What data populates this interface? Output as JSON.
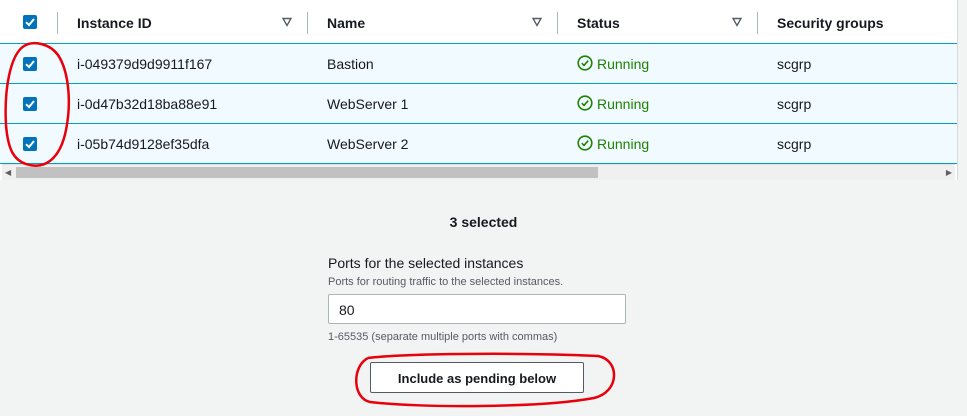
{
  "table": {
    "columns": [
      {
        "label": "Instance ID"
      },
      {
        "label": "Name"
      },
      {
        "label": "Status"
      },
      {
        "label": "Security groups"
      }
    ],
    "rows": [
      {
        "instance_id": "i-049379d9d9911f167",
        "name": "Bastion",
        "status": "Running",
        "security_groups": "scgrp",
        "selected": true
      },
      {
        "instance_id": "i-0d47b32d18ba88e91",
        "name": "WebServer 1",
        "status": "Running",
        "security_groups": "scgrp",
        "selected": true
      },
      {
        "instance_id": "i-05b74d9128ef35dfa",
        "name": "WebServer 2",
        "status": "Running",
        "security_groups": "scgrp",
        "selected": true
      }
    ]
  },
  "selection": {
    "count_label": "3 selected"
  },
  "ports": {
    "label": "Ports for the selected instances",
    "description": "Ports for routing traffic to the selected instances.",
    "value": "80",
    "hint": "1-65535 (separate multiple ports with commas)"
  },
  "include_button": {
    "label": "Include as pending below"
  },
  "colors": {
    "accent": "#0073bb",
    "running": "#1d8102",
    "row_selected_bg": "#f1faff",
    "row_border": "#00a1c9",
    "annotation": "#e8000b"
  }
}
